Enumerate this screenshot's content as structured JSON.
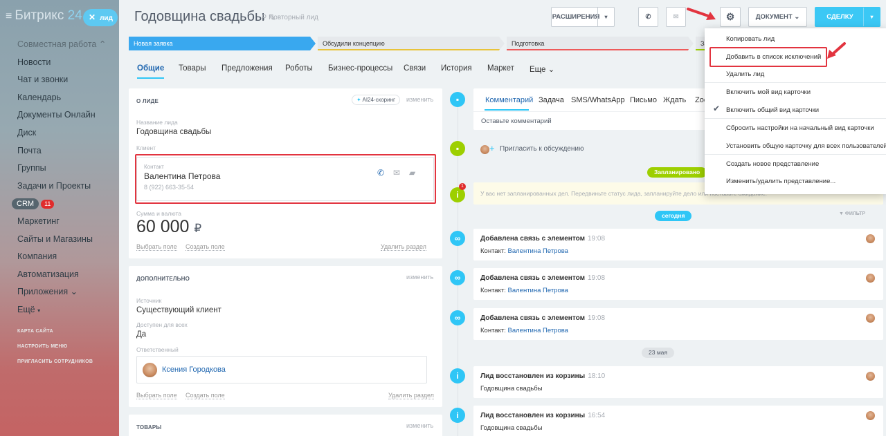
{
  "sidebar": {
    "logo_main": "Битрикс",
    "logo_num": "24",
    "lead_pill": "лид",
    "items": [
      "Совместная работа",
      "Новости",
      "Чат и звонки",
      "Календарь",
      "Документы Онлайн",
      "Диск",
      "Почта",
      "Группы",
      "Задачи и Проекты",
      "CRM",
      "Маркетинг",
      "Сайты и Магазины",
      "Компания",
      "Автоматизация",
      "Приложения",
      "Ещё"
    ],
    "crm_badge": "11",
    "bottom": [
      "КАРТА САЙТА",
      "НАСТРОИТЬ МЕНЮ",
      "ПРИГЛАСИТЬ СОТРУДНИКОВ"
    ]
  },
  "header": {
    "title": "Годовщина свадьбы",
    "subtitle": "Повторный лид",
    "btn_ext": "РАСШИРЕНИЯ",
    "btn_doc": "ДОКУМЕНТ",
    "btn_deal": "СДЕЛКУ"
  },
  "stages": [
    "Новая заявка",
    "Обсудили концепцию",
    "Подготовка",
    "За"
  ],
  "tabs": [
    "Общие",
    "Товары",
    "Предложения",
    "Роботы",
    "Бизнес-процессы",
    "Связи",
    "История",
    "Маркет",
    "Еще"
  ],
  "lead_card": {
    "head": "О ЛИДЕ",
    "ai": "AI24-скоринг",
    "edit": "изменить",
    "name_label": "Название лида",
    "name": "Годовщина свадьбы",
    "client_label": "Клиент",
    "contact_label": "Контакт",
    "contact_name": "Валентина Петрова",
    "contact_phone": "8 (922) 663-35-54",
    "sum_label": "Сумма и валюта",
    "sum": "60 000",
    "currency": "₽",
    "choose": "Выбрать поле",
    "create": "Создать поле",
    "delete": "Удалить раздел"
  },
  "extra_card": {
    "head": "ДОПОЛНИТЕЛЬНО",
    "edit": "изменить",
    "source_label": "Источник",
    "source": "Существующий клиент",
    "avail_label": "Доступен для всех",
    "avail": "Да",
    "resp_label": "Ответственный",
    "resp": "Ксения Городкова",
    "choose": "Выбрать поле",
    "create": "Создать поле",
    "delete": "Удалить раздел"
  },
  "goods_card": {
    "head": "ТОВАРЫ",
    "edit": "изменить"
  },
  "composer": {
    "tabs": [
      "Комментарий",
      "Задача",
      "SMS/WhatsApp",
      "Письмо",
      "Ждать",
      "Zoo"
    ],
    "placeholder": "Оставьте комментарий",
    "invite": "Пригласить к обсуждению"
  },
  "timeline": {
    "planned": "Запланировано",
    "planned_text": "У вас нет запланированных дел. Передвиньте статус лида, запланируйте дело или поставьте ожидание.",
    "today": "сегодня",
    "filter": "ФИЛЬТР",
    "date2": "23 мая",
    "items": [
      {
        "title": "Добавлена связь с элементом",
        "time": "19:08",
        "sub_label": "Контакт:",
        "sub_link": "Валентина Петрова"
      },
      {
        "title": "Добавлена связь с элементом",
        "time": "19:08",
        "sub_label": "Контакт:",
        "sub_link": "Валентина Петрова"
      },
      {
        "title": "Добавлена связь с элементом",
        "time": "19:08",
        "sub_label": "Контакт:",
        "sub_link": "Валентина Петрова"
      },
      {
        "title": "Лид восстановлен из корзины",
        "time": "18:10",
        "sub_label": "Годовщина свадьбы",
        "sub_link": ""
      },
      {
        "title": "Лид восстановлен из корзины",
        "time": "16:54",
        "sub_label": "Годовщина свадьбы",
        "sub_link": ""
      }
    ]
  },
  "menu": [
    "Копировать лид",
    "Добавить в список исключений",
    "Удалить лид",
    "Включить мой вид карточки",
    "Включить общий вид карточки",
    "Сбросить настройки на начальный вид карточки",
    "Установить общую карточку для всех пользователей",
    "Создать новое представление",
    "Изменить/удалить представление..."
  ],
  "colors": {
    "accent": "#2fc6f6",
    "highlight": "#e2343f",
    "planned": "#9dcf00",
    "link": "#2067b0"
  }
}
